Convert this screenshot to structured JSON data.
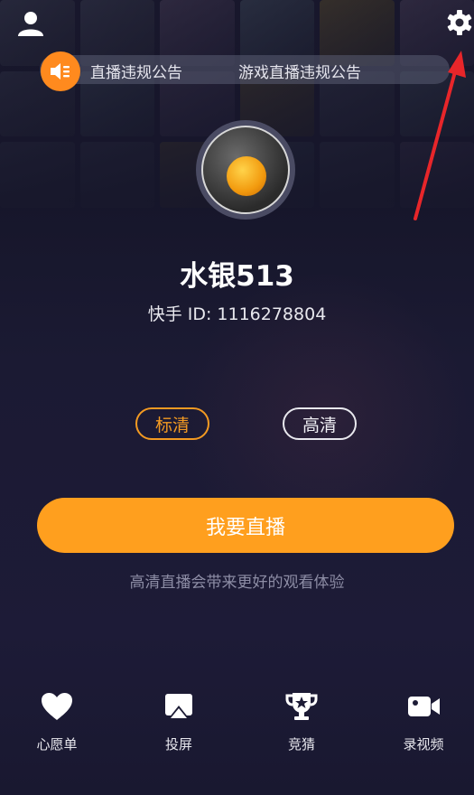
{
  "header": {
    "user_icon": "user-icon",
    "settings_icon": "gear-icon"
  },
  "notice": {
    "icon": "speaker-icon",
    "items": [
      "直播违规公告",
      "游戏直播违规公告"
    ]
  },
  "profile": {
    "avatar": "orange-avatar",
    "username": "水银513",
    "id_text": "快手 ID: 1116278804"
  },
  "quality": {
    "options": [
      "标清",
      "高清"
    ],
    "selected": "标清"
  },
  "go_live": {
    "label": "我要直播",
    "hint": "高清直播会带来更好的观看体验"
  },
  "bottom_nav": [
    {
      "label": "心愿单",
      "icon": "heart-icon"
    },
    {
      "label": "投屏",
      "icon": "cast-icon"
    },
    {
      "label": "竞猜",
      "icon": "trophy-icon"
    },
    {
      "label": "录视频",
      "icon": "video-camera-icon"
    }
  ],
  "colors": {
    "accent": "#ff9f1e",
    "background": "#1b1a33",
    "annotation_arrow": "#e8262a"
  }
}
